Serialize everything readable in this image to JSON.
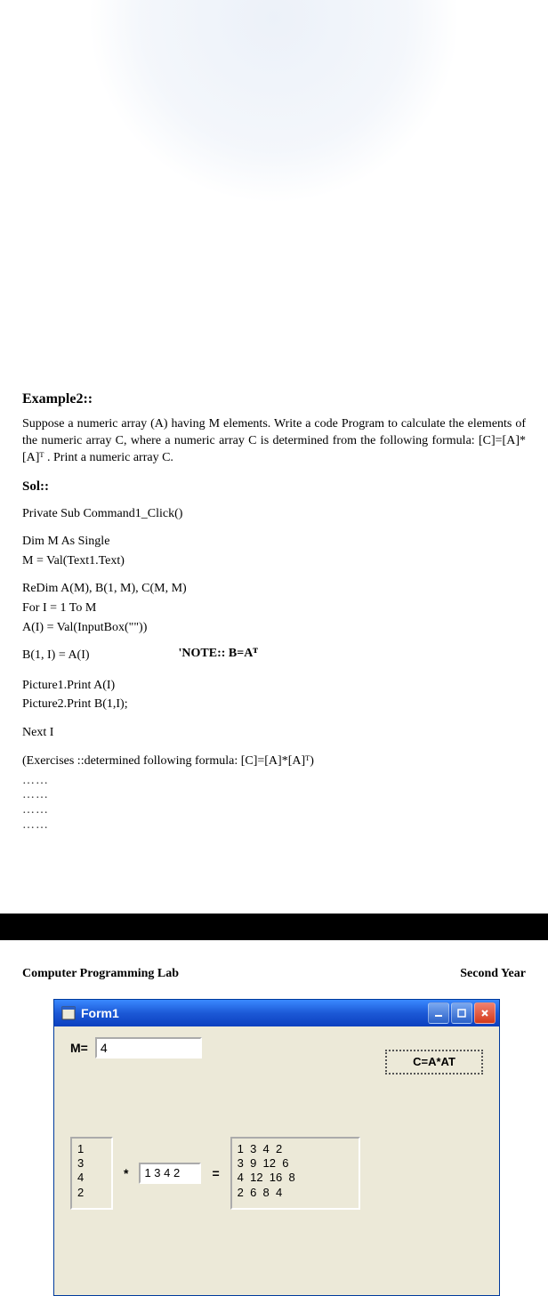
{
  "example_heading": "Example2::",
  "problem_text": "Suppose a numeric array (A) having M elements. Write a code Program to calculate the elements of the numeric array C, where a numeric array C is determined from the following formula: [C]=[A]*[A]ᵀ . Print a numeric array C.",
  "sol_heading": "Sol::",
  "code": {
    "l1": "Private Sub Command1_Click()",
    "l2": "Dim M As Single",
    "l3": "M = Val(Text1.Text)",
    "l4": "ReDim A(M), B(1, M), C(M, M)",
    "l5": "For I = 1 To M",
    "l6": "A(I) = Val(InputBox(\"\"))",
    "l7a": "B(1, I) = A(I)",
    "l7b": "'NOTE:: B=Aᵀ",
    "l8": "Picture1.Print A(I)",
    "l9": "Picture2.Print B(1,I);",
    "l10": "Next I"
  },
  "exercises_label": "(Exercises ::determined  following formula: [C]=[A]*[A]ᵀ)",
  "dots": "……",
  "footer_left": "Computer Programming Lab",
  "footer_right": "Second Year",
  "form": {
    "title": "Form1",
    "m_label": "M=",
    "m_value": "4",
    "button_label": "C=A*AT",
    "picA": "1\n3\n4\n2",
    "op_mul": "*",
    "inputB_value": "1 3 4 2",
    "op_eq": "=",
    "picC": "1  3  4  2\n3  9  12  6\n4  12  16  8\n2  6  8  4"
  }
}
